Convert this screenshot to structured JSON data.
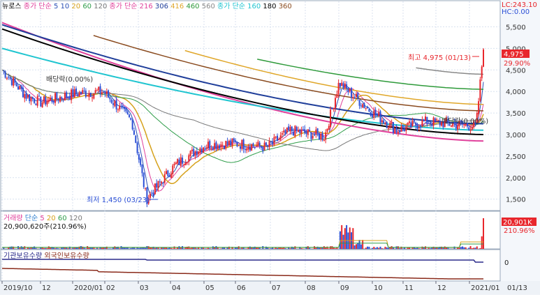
{
  "legend": {
    "price": [
      {
        "text": "뉴로스",
        "color": "#000000"
      },
      {
        "text": "종가 단순",
        "color": "#e0409b"
      },
      {
        "text": "5",
        "color": "#2a4fb5"
      },
      {
        "text": "10",
        "color": "#2a4fb5"
      },
      {
        "text": "20",
        "color": "#d6a11b"
      },
      {
        "text": "60",
        "color": "#2f9d4a"
      },
      {
        "text": "120",
        "color": "#777777"
      },
      {
        "text": "종가 단순",
        "color": "#e0409b"
      },
      {
        "text": "216",
        "color": "#e0409b"
      },
      {
        "text": "306",
        "color": "#1f3e9a"
      },
      {
        "text": "416",
        "color": "#e0a72a"
      },
      {
        "text": "460",
        "color": "#2e9a3a"
      },
      {
        "text": "560",
        "color": "#888888"
      },
      {
        "text": "종가 단순",
        "color": "#20c5d0"
      },
      {
        "text": "160",
        "color": "#20c5d0"
      },
      {
        "text": "180",
        "color": "#000000"
      },
      {
        "text": "360",
        "color": "#8a4b1f"
      }
    ],
    "volume": [
      {
        "text": "거래량",
        "color": "#e0409b"
      },
      {
        "text": "단순",
        "color": "#2f7fd0"
      },
      {
        "text": "5",
        "color": "#e0409b"
      },
      {
        "text": "20",
        "color": "#d6a11b"
      },
      {
        "text": "60",
        "color": "#2f9d4a"
      },
      {
        "text": "120",
        "color": "#777777"
      }
    ],
    "holdings": [
      {
        "text": "기관보유수량",
        "color": "#2a2a8a"
      },
      {
        "text": "외국인보유수량",
        "color": "#8a2a1a"
      }
    ]
  },
  "info": {
    "lc": "LC:243.10",
    "hc": "HC:0.00"
  },
  "price_axis": {
    "ticks": [
      "5,500",
      "5,000",
      "4,500",
      "4,000",
      "3,500",
      "3,000",
      "2,500",
      "2,000",
      "1,500"
    ],
    "current": "4,975",
    "change": "29.90%"
  },
  "volume_axis": {
    "current": "20,901K",
    "change": "210.96%"
  },
  "volume_label": "20,900,620주(210.96%)",
  "holdings_axis": {
    "zero": "0"
  },
  "annotations": {
    "high": "최고 4,975 (01/13)",
    "low": "최저 1,450 (03/23)",
    "dividend_left": "배당락(0.00%)",
    "dividend_right": "배당락(0.00%)"
  },
  "x_axis": [
    "2019/10",
    "12",
    "2020/01",
    "02",
    "03",
    "04",
    "05",
    "06",
    "07",
    "08",
    "09",
    "10",
    "11",
    "12",
    "2021/01",
    "01/13"
  ],
  "colors": {
    "up": "#e8262c",
    "down": "#2b4fd6",
    "grid": "#d8e2ef",
    "axis_bg": "#f4f7fb"
  },
  "chart_data": {
    "type": "candlestick",
    "symbol": "뉴로스",
    "ylim": [
      1300,
      5800
    ],
    "yticks": [
      5500,
      5000,
      4500,
      4000,
      3500,
      3000,
      2500,
      2000,
      1500
    ],
    "high": {
      "value": 4975,
      "date": "01/13"
    },
    "low": {
      "value": 1450,
      "date": "03/23"
    },
    "close_path": [
      {
        "x": "2019/10",
        "y": 4500
      },
      {
        "x": "11",
        "y": 3900
      },
      {
        "x": "12",
        "y": 3750
      },
      {
        "x": "2020/01",
        "y": 3950
      },
      {
        "x": "02",
        "y": 4000
      },
      {
        "x": "03 (early)",
        "y": 3300
      },
      {
        "x": "03/23",
        "y": 1500
      },
      {
        "x": "04",
        "y": 2300
      },
      {
        "x": "05",
        "y": 2750
      },
      {
        "x": "06",
        "y": 2800
      },
      {
        "x": "07",
        "y": 2700
      },
      {
        "x": "07 (late)",
        "y": 3100
      },
      {
        "x": "08",
        "y": 2950
      },
      {
        "x": "09",
        "y": 4200
      },
      {
        "x": "10",
        "y": 3600
      },
      {
        "x": "11",
        "y": 3100
      },
      {
        "x": "12",
        "y": 3300
      },
      {
        "x": "2021/01",
        "y": 3200
      },
      {
        "x": "01/13",
        "y": 4975
      }
    ],
    "volume": {
      "last": 20900620,
      "last_change_pct": 210.96
    }
  }
}
